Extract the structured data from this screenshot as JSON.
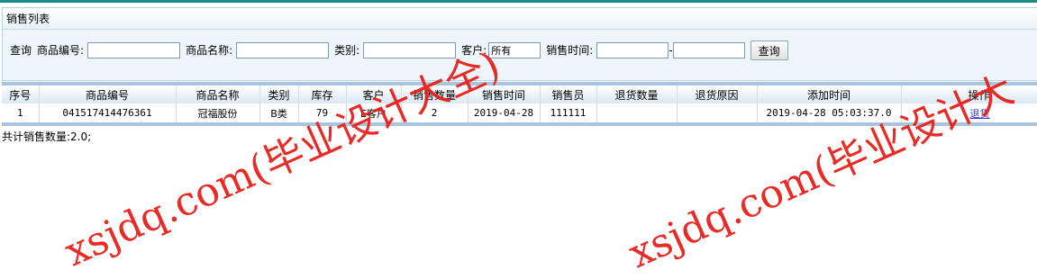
{
  "panel": {
    "title": "销售列表"
  },
  "search": {
    "query_label": "查询",
    "code_label": "商品编号:",
    "name_label": "商品名称:",
    "category_label": "类别:",
    "customer_label": "客户:",
    "customer_value": "所有",
    "time_label": "销售时间:",
    "range_sep": "-",
    "button_label": "查询"
  },
  "table": {
    "headers": [
      "序号",
      "商品编号",
      "商品名称",
      "类别",
      "库存",
      "客户",
      "销售数量",
      "销售时间",
      "销售员",
      "退货数量",
      "退货原因",
      "添加时间",
      "操作"
    ],
    "rows": [
      {
        "index": "1",
        "code": "041517414476361",
        "name": "冠福股份",
        "category": "B类",
        "stock": "79",
        "customer": "E客户",
        "quantity": "2",
        "sale_time": "2019-04-28",
        "seller": "111111",
        "return_qty": "",
        "return_reason": "",
        "added_time": "2019-04-28 05:03:37.0",
        "action": "退货"
      }
    ]
  },
  "total_text": "共计销售数量:2.0;",
  "watermarks": [
    "xsjdq.com(毕业设计大全)",
    "xsjdq.com(毕业设计大"
  ],
  "colors": {
    "accent": "#1a8a8a",
    "watermark": "#e8201c",
    "header_band": "#a9c4dd"
  }
}
